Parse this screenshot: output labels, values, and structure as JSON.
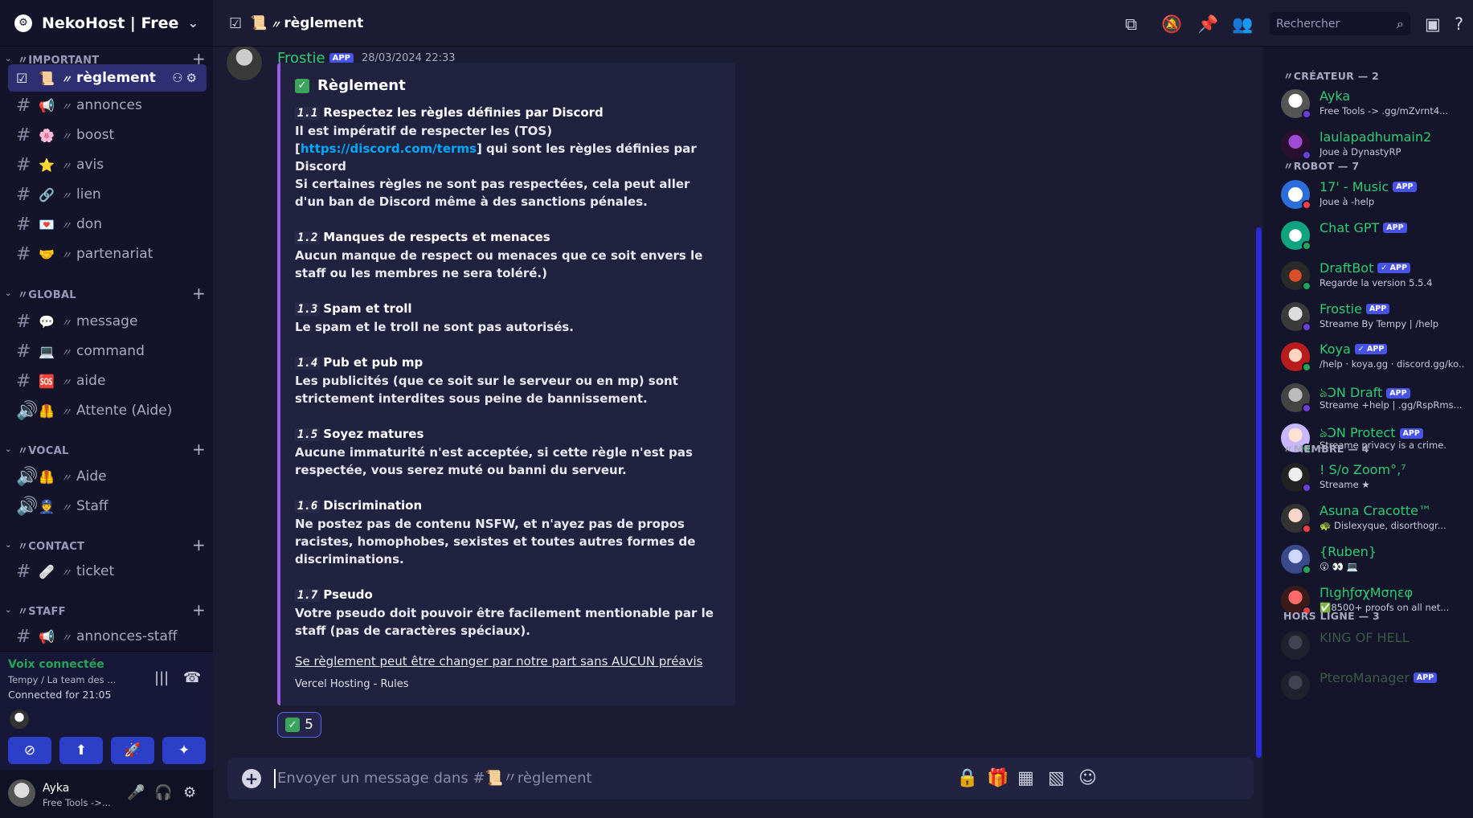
{
  "server": {
    "name": "NekoHost | Free"
  },
  "categories": {
    "important": "〃IMPORTANT",
    "global": "〃GLOBAL",
    "vocal": "〃VOCAL",
    "contact": "〃CONTACT",
    "staff": "〃STAFF"
  },
  "channels": {
    "reglement": {
      "emoji": "📜",
      "name": "règlement"
    },
    "annonces": {
      "emoji": "📢",
      "name": "annonces"
    },
    "boost": {
      "emoji": "🌸",
      "name": "boost"
    },
    "avis": {
      "emoji": "⭐",
      "name": "avis"
    },
    "lien": {
      "emoji": "🔗",
      "name": "lien"
    },
    "don": {
      "emoji": "💌",
      "name": "don"
    },
    "partenariat": {
      "emoji": "🤝",
      "name": "partenariat"
    },
    "message": {
      "emoji": "💬",
      "name": "message"
    },
    "command": {
      "emoji": "💻",
      "name": "command"
    },
    "aide": {
      "emoji": "🆘",
      "name": "aide"
    },
    "attente": {
      "emoji": "🦺",
      "name": "Attente (Aide)"
    },
    "vocal_aide": {
      "emoji": "🦺",
      "name": "Aide"
    },
    "vocal_staff": {
      "emoji": "👮",
      "name": "Staff"
    },
    "ticket": {
      "emoji": "🩹",
      "name": "ticket"
    },
    "annonces_staff": {
      "emoji": "📢",
      "name": "annonces-staff"
    }
  },
  "slash": "〃",
  "voice": {
    "status": "Voix connectée",
    "sub": "Tempy / La team des ...",
    "time": "Connected for 21:05"
  },
  "user": {
    "name": "Ayka",
    "sub": "Free Tools ->..."
  },
  "topbar": {
    "channel_emoji": "📜",
    "channel_name": "règlement",
    "search_placeholder": "Rechercher"
  },
  "message": {
    "author": "Frostie",
    "badge": "APP",
    "timestamp": "28/03/2024 22:33",
    "embed": {
      "title": "Règlement",
      "rules": [
        {
          "num": "1.1",
          "title": "Respectez les règles définies par Discord",
          "body": "Il est impératif de respecter les (TOS)[",
          "link": "https://discord.com/terms",
          "body_after": "] qui sont les règles définies par Discord\nSi certaines règles ne sont pas respectées, cela peut aller d'un ban de Discord même à des sanctions pénales."
        },
        {
          "num": "1.2",
          "title": "Manques de respects et menaces",
          "body": "Aucun manque de respect ou menaces que ce soit envers le staff ou les membres ne sera toléré.)"
        },
        {
          "num": "1.3",
          "title": "Spam et troll",
          "body": "Le spam et le troll ne sont pas autorisés."
        },
        {
          "num": "1.4",
          "title": "Pub et pub mp",
          "body": "Les publicités (que ce soit sur le serveur ou en mp) sont strictement interdites sous peine de bannissement."
        },
        {
          "num": "1.5",
          "title": "Soyez matures",
          "body": "Aucune immaturité n'est acceptée, si cette règle n'est pas respectée, vous serez muté ou banni du serveur."
        },
        {
          "num": "1.6",
          "title": "Discrimination",
          "body": "Ne postez pas de contenu NSFW, et n'ayez pas de propos racistes, homophobes, sexistes et toutes autres formes de discriminations."
        },
        {
          "num": "1.7",
          "title": "Pseudo",
          "body": "Votre pseudo doit pouvoir être facilement mentionable par le staff (pas de caractères spéciaux)."
        }
      ],
      "notice": "Se règlement peut être changer par notre part sans AUCUN préavis",
      "footer": "Vercel Hosting - Rules"
    },
    "reaction": {
      "emoji": "✅",
      "count": "5"
    }
  },
  "composer": {
    "placeholder": "Envoyer un message dans #📜〃règlement"
  },
  "members": {
    "cat_createur": "〃CRÉATEUR — 2",
    "cat_robot": "〃ROBOT — 7",
    "cat_membre": "〃MEMBRE — 4",
    "cat_offline": "HORS LIGNE — 3",
    "createur": [
      {
        "name": "Ayka",
        "sub": "Free Tools -> .gg/mZvrnt4..."
      },
      {
        "name": "laulapadhumain2",
        "sub": "Joue à DynastyRP"
      }
    ],
    "robot": [
      {
        "name": "17' - Music",
        "sub": "Joue à -help",
        "badge": "APP"
      },
      {
        "name": "Chat GPT",
        "sub": "",
        "badge": "APP"
      },
      {
        "name": "DraftBot",
        "sub": "Regarde la version 5.5.4",
        "badge": "✓ APP"
      },
      {
        "name": "Frostie",
        "sub": "Streame By Tempy | /help",
        "badge": "APP"
      },
      {
        "name": "Koya",
        "sub": "/help · koya.gg · discord.gg/ko...",
        "badge": "✓ APP"
      },
      {
        "name": "ঌƆN Draft",
        "sub": "Streame +help | .gg/RspRms...",
        "badge": "APP"
      },
      {
        "name": "ঌƆN Protect",
        "sub": "Streame privacy is a crime.",
        "badge": "APP"
      }
    ],
    "membre": [
      {
        "name": "! S/o Zoom°‚⁷",
        "sub": "Streame ★"
      },
      {
        "name": "Asuna Cracotte™",
        "sub": "🐢 Dislexyque, disorthogr..."
      },
      {
        "name": "{Ruben}",
        "sub": "😮 👀 💻"
      },
      {
        "name": "ΠιghƒσχΜσηεφ",
        "sub": "✅8500+ proofs on all net..."
      }
    ],
    "offline": [
      {
        "name": "KING OF HELL",
        "sub": ""
      },
      {
        "name": "PteroManager",
        "sub": "",
        "badge": "APP"
      }
    ]
  },
  "colors": {
    "accent": "#4752e6",
    "online": "#23a559",
    "dnd": "#f23f43",
    "idle": "#6c3fd9",
    "name_green": "#2ecc71",
    "link": "#00a8fc",
    "embed_border": "#9b5de5"
  },
  "icons": [
    "server-icon",
    "chevron-down-icon",
    "hash-icon",
    "speaker-icon",
    "plus-icon",
    "threads-icon",
    "mute-icon",
    "pin-icon",
    "members-icon",
    "search-icon",
    "inbox-icon",
    "help-icon",
    "gift-icon",
    "gif-icon",
    "sticker-icon",
    "emoji-icon",
    "lock-icon",
    "mic-icon",
    "headset-icon",
    "gear-icon"
  ]
}
